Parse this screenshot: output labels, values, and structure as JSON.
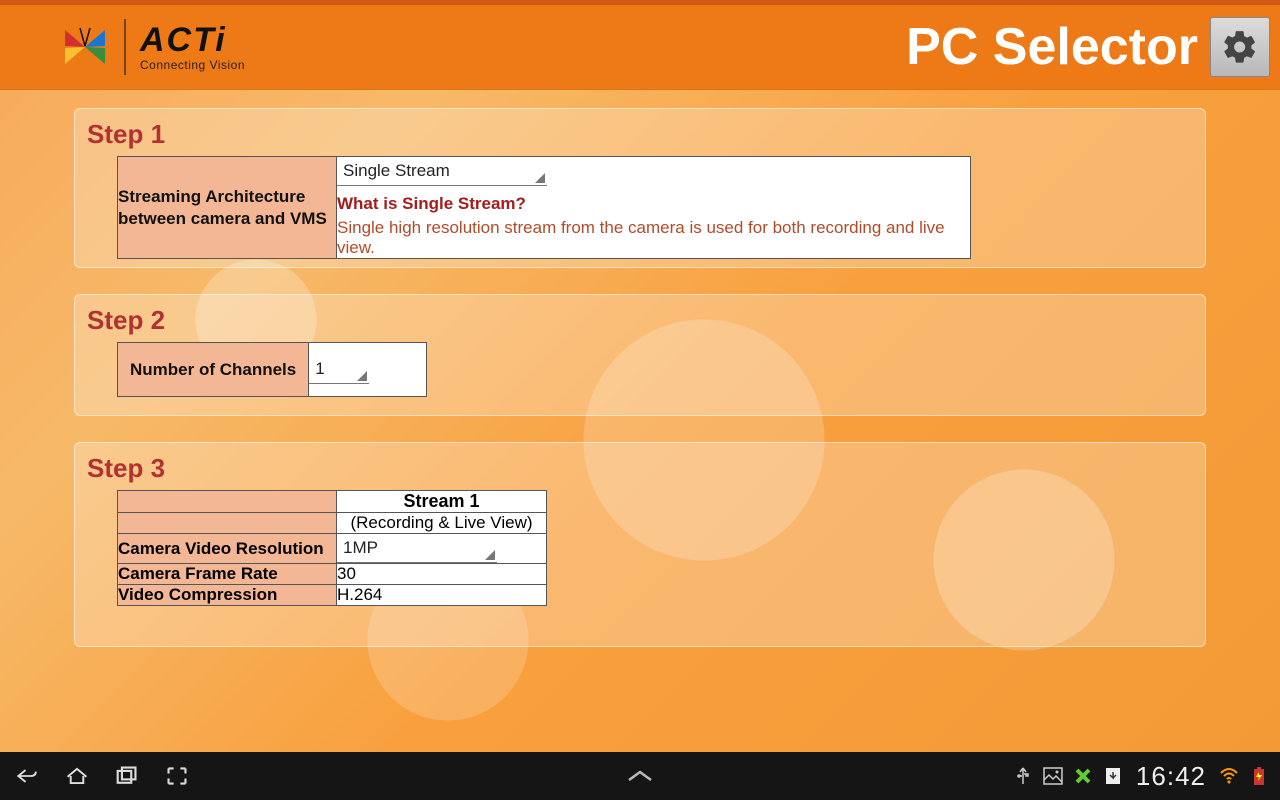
{
  "header": {
    "brand": "ACTi",
    "tagline": "Connecting Vision",
    "title": "PC Selector"
  },
  "step1": {
    "title": "Step 1",
    "label": "Streaming Architecture between camera and VMS",
    "dropdown": "Single Stream",
    "question": "What is Single Stream?",
    "answer": "Single high resolution stream from the camera is used for both recording and live view."
  },
  "step2": {
    "title": "Step 2",
    "label": "Number of Channels",
    "value": "1"
  },
  "step3": {
    "title": "Step 3",
    "col_header": "Stream 1",
    "col_sub": "(Recording & Live View)",
    "rows": [
      {
        "label": "Camera Video Resolution",
        "value": "1MP",
        "dropdown": true
      },
      {
        "label": "Camera Frame Rate",
        "value": "30",
        "dropdown": false
      },
      {
        "label": "Video Compression",
        "value": "H.264",
        "dropdown": false
      }
    ]
  },
  "status": {
    "time": "16:42"
  },
  "colors": {
    "brandOrange": "#ee7a17",
    "accentRed": "#b43131"
  }
}
